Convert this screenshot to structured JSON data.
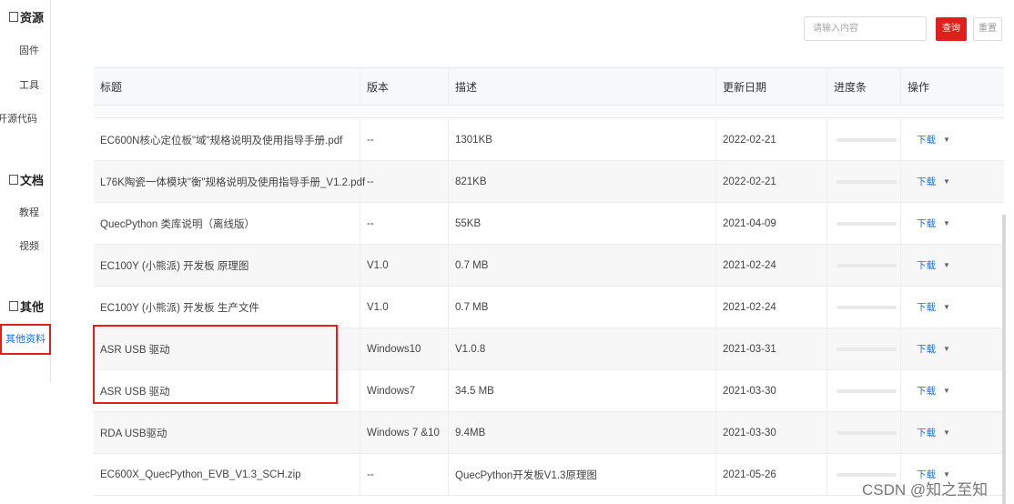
{
  "sidebar": {
    "sections": [
      {
        "label": "资源",
        "items": [
          "固件",
          "工具",
          "开源代码"
        ]
      },
      {
        "label": "文档",
        "items": [
          "教程",
          "视频"
        ]
      },
      {
        "label": "其他",
        "items": [
          "其他资料"
        ]
      }
    ]
  },
  "search": {
    "placeholder": "请输入内容",
    "query_label": "查询",
    "reset_label": "重置"
  },
  "table": {
    "headers": [
      "标题",
      "版本",
      "描述",
      "更新日期",
      "进度条",
      "操作"
    ],
    "rows": [
      {
        "title": "EC600N核心定位板\"域\"规格说明及使用指导手册.pdf",
        "version": "--",
        "desc": "1301KB",
        "date": "2022-02-21",
        "progress": 0,
        "action": "下载"
      },
      {
        "title": "L76K陶瓷一体模块\"衡\"规格说明及使用指导手册_V1.2.pdf",
        "version": "--",
        "desc": "821KB",
        "date": "2022-02-21",
        "progress": 0,
        "action": "下载"
      },
      {
        "title": "QuecPython 类库说明（离线版）",
        "version": "--",
        "desc": "55KB",
        "date": "2021-04-09",
        "progress": 0,
        "action": "下载"
      },
      {
        "title": "EC100Y (小熊派) 开发板 原理图",
        "version": "V1.0",
        "desc": "0.7 MB",
        "date": "2021-02-24",
        "progress": 0,
        "action": "下载"
      },
      {
        "title": "EC100Y (小熊派) 开发板 生产文件",
        "version": "V1.0",
        "desc": "0.7 MB",
        "date": "2021-02-24",
        "progress": 0,
        "action": "下载"
      },
      {
        "title": "ASR USB 驱动",
        "version": "Windows10",
        "desc": "V1.0.8",
        "date": "2021-03-31",
        "progress": 0,
        "action": "下载"
      },
      {
        "title": "ASR USB 驱动",
        "version": "Windows7",
        "desc": "34.5 MB",
        "date": "2021-03-30",
        "progress": 0,
        "action": "下载"
      },
      {
        "title": "RDA USB驱动",
        "version": "Windows 7 &10",
        "desc": "9.4MB",
        "date": "2021-03-30",
        "progress": 0,
        "action": "下载"
      },
      {
        "title": "EC600X_QuecPython_EVB_V1.3_SCH.zip",
        "version": "--",
        "desc": "QuecPython开发板V1.3原理图",
        "date": "2021-05-26",
        "progress": 0,
        "action": "下载"
      }
    ]
  },
  "watermark": "CSDN @知之至知",
  "colors": {
    "accent": "#e0201d",
    "link": "#1e6fd9"
  }
}
